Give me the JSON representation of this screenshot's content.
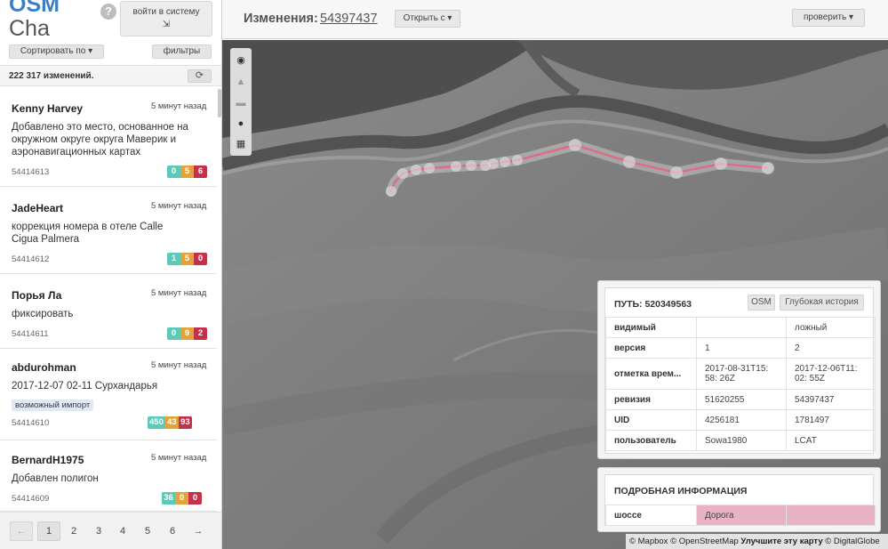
{
  "brand": {
    "title": "OSM",
    "subtitle": "Cha"
  },
  "help_label": "?",
  "login_button": {
    "label": "войти в систему",
    "icon": "login-icon",
    "glyph": "⇲"
  },
  "sort_button": "Сортировать по",
  "filters_button": "фильтры",
  "changes_count": "222 317 изменений.",
  "refresh_icon": "⟳",
  "changesets": [
    {
      "user": "Kenny Harvey",
      "time": "5 минут назад",
      "comment": "Добавлено это место, основанное на окружном округе округа Маверик и аэронавигационных картах",
      "id": "54414613",
      "tag": "",
      "added": "0",
      "modified": "5",
      "deleted": "6"
    },
    {
      "user": "JadeHeart",
      "time": "5 минут назад",
      "comment": "коррекция номера в отеле Calle Cigua Palmera",
      "id": "54414612",
      "tag": "",
      "added": "1",
      "modified": "5",
      "deleted": "0"
    },
    {
      "user": "Порья Ла",
      "time": "5 минут назад",
      "comment": "фиксировать",
      "id": "54414611",
      "tag": "",
      "added": "0",
      "modified": "9",
      "deleted": "2"
    },
    {
      "user": "abdurohman",
      "time": "5 минут назад",
      "comment": "2017-12-07 02-11 Сурхандарья",
      "id": "54414610",
      "tag": "возможный импорт",
      "added": "450",
      "modified": "43",
      "deleted": "93"
    },
    {
      "user": "BernardH1975",
      "time": "5 минут назад",
      "comment": "Добавлен полигон",
      "id": "54414609",
      "tag": "",
      "added": "36",
      "modified": "0",
      "deleted": "0"
    }
  ],
  "pagination": {
    "prev": "←",
    "pages": [
      "1",
      "2",
      "3",
      "4",
      "5",
      "6"
    ],
    "next": "→",
    "current": "1"
  },
  "header": {
    "label": "Изменения:",
    "changeset_id": "54397437",
    "open_button": "Открыть с",
    "check_button": "проверить"
  },
  "map_tools": [
    "eye-icon",
    "warning-icon",
    "comment-icon",
    "user-icon",
    "map-icon"
  ],
  "way_panel": {
    "title": "ПУТЬ: 520349563",
    "osm_button": "OSM",
    "history_button": "Глубокая история",
    "rows": [
      {
        "key": "видимый",
        "old": "",
        "new": "ложный"
      },
      {
        "key": "версия",
        "old": "1",
        "new": "2"
      },
      {
        "key": "отметка врем...",
        "old": "2017-08-31T15: 58: 26Z",
        "new": "2017-12-06T11: 02: 55Z"
      },
      {
        "key": "ревизия",
        "old": "51620255",
        "new": "54397437"
      },
      {
        "key": "UID",
        "old": "4256181",
        "new": "1781497"
      },
      {
        "key": "пользователь",
        "old": "Sowa1980",
        "new": "LCAT"
      }
    ]
  },
  "details_panel": {
    "title": "ПОДРОБНАЯ ИНФОРМАЦИЯ",
    "row": {
      "key": "шоссе",
      "old": "Дорога",
      "new": ""
    }
  },
  "attribution": {
    "prefix": "© Mapbox © OpenStreetMap",
    "improve": "Улучшите эту карту",
    "suffix": "© DigitalGlobe"
  },
  "colors": {
    "brand": "#3b7fc4",
    "added": "#5bcab8",
    "modified": "#e0a43b",
    "deleted": "#c4314b",
    "highlight": "#e8b4c3",
    "way": "#e06b86"
  }
}
